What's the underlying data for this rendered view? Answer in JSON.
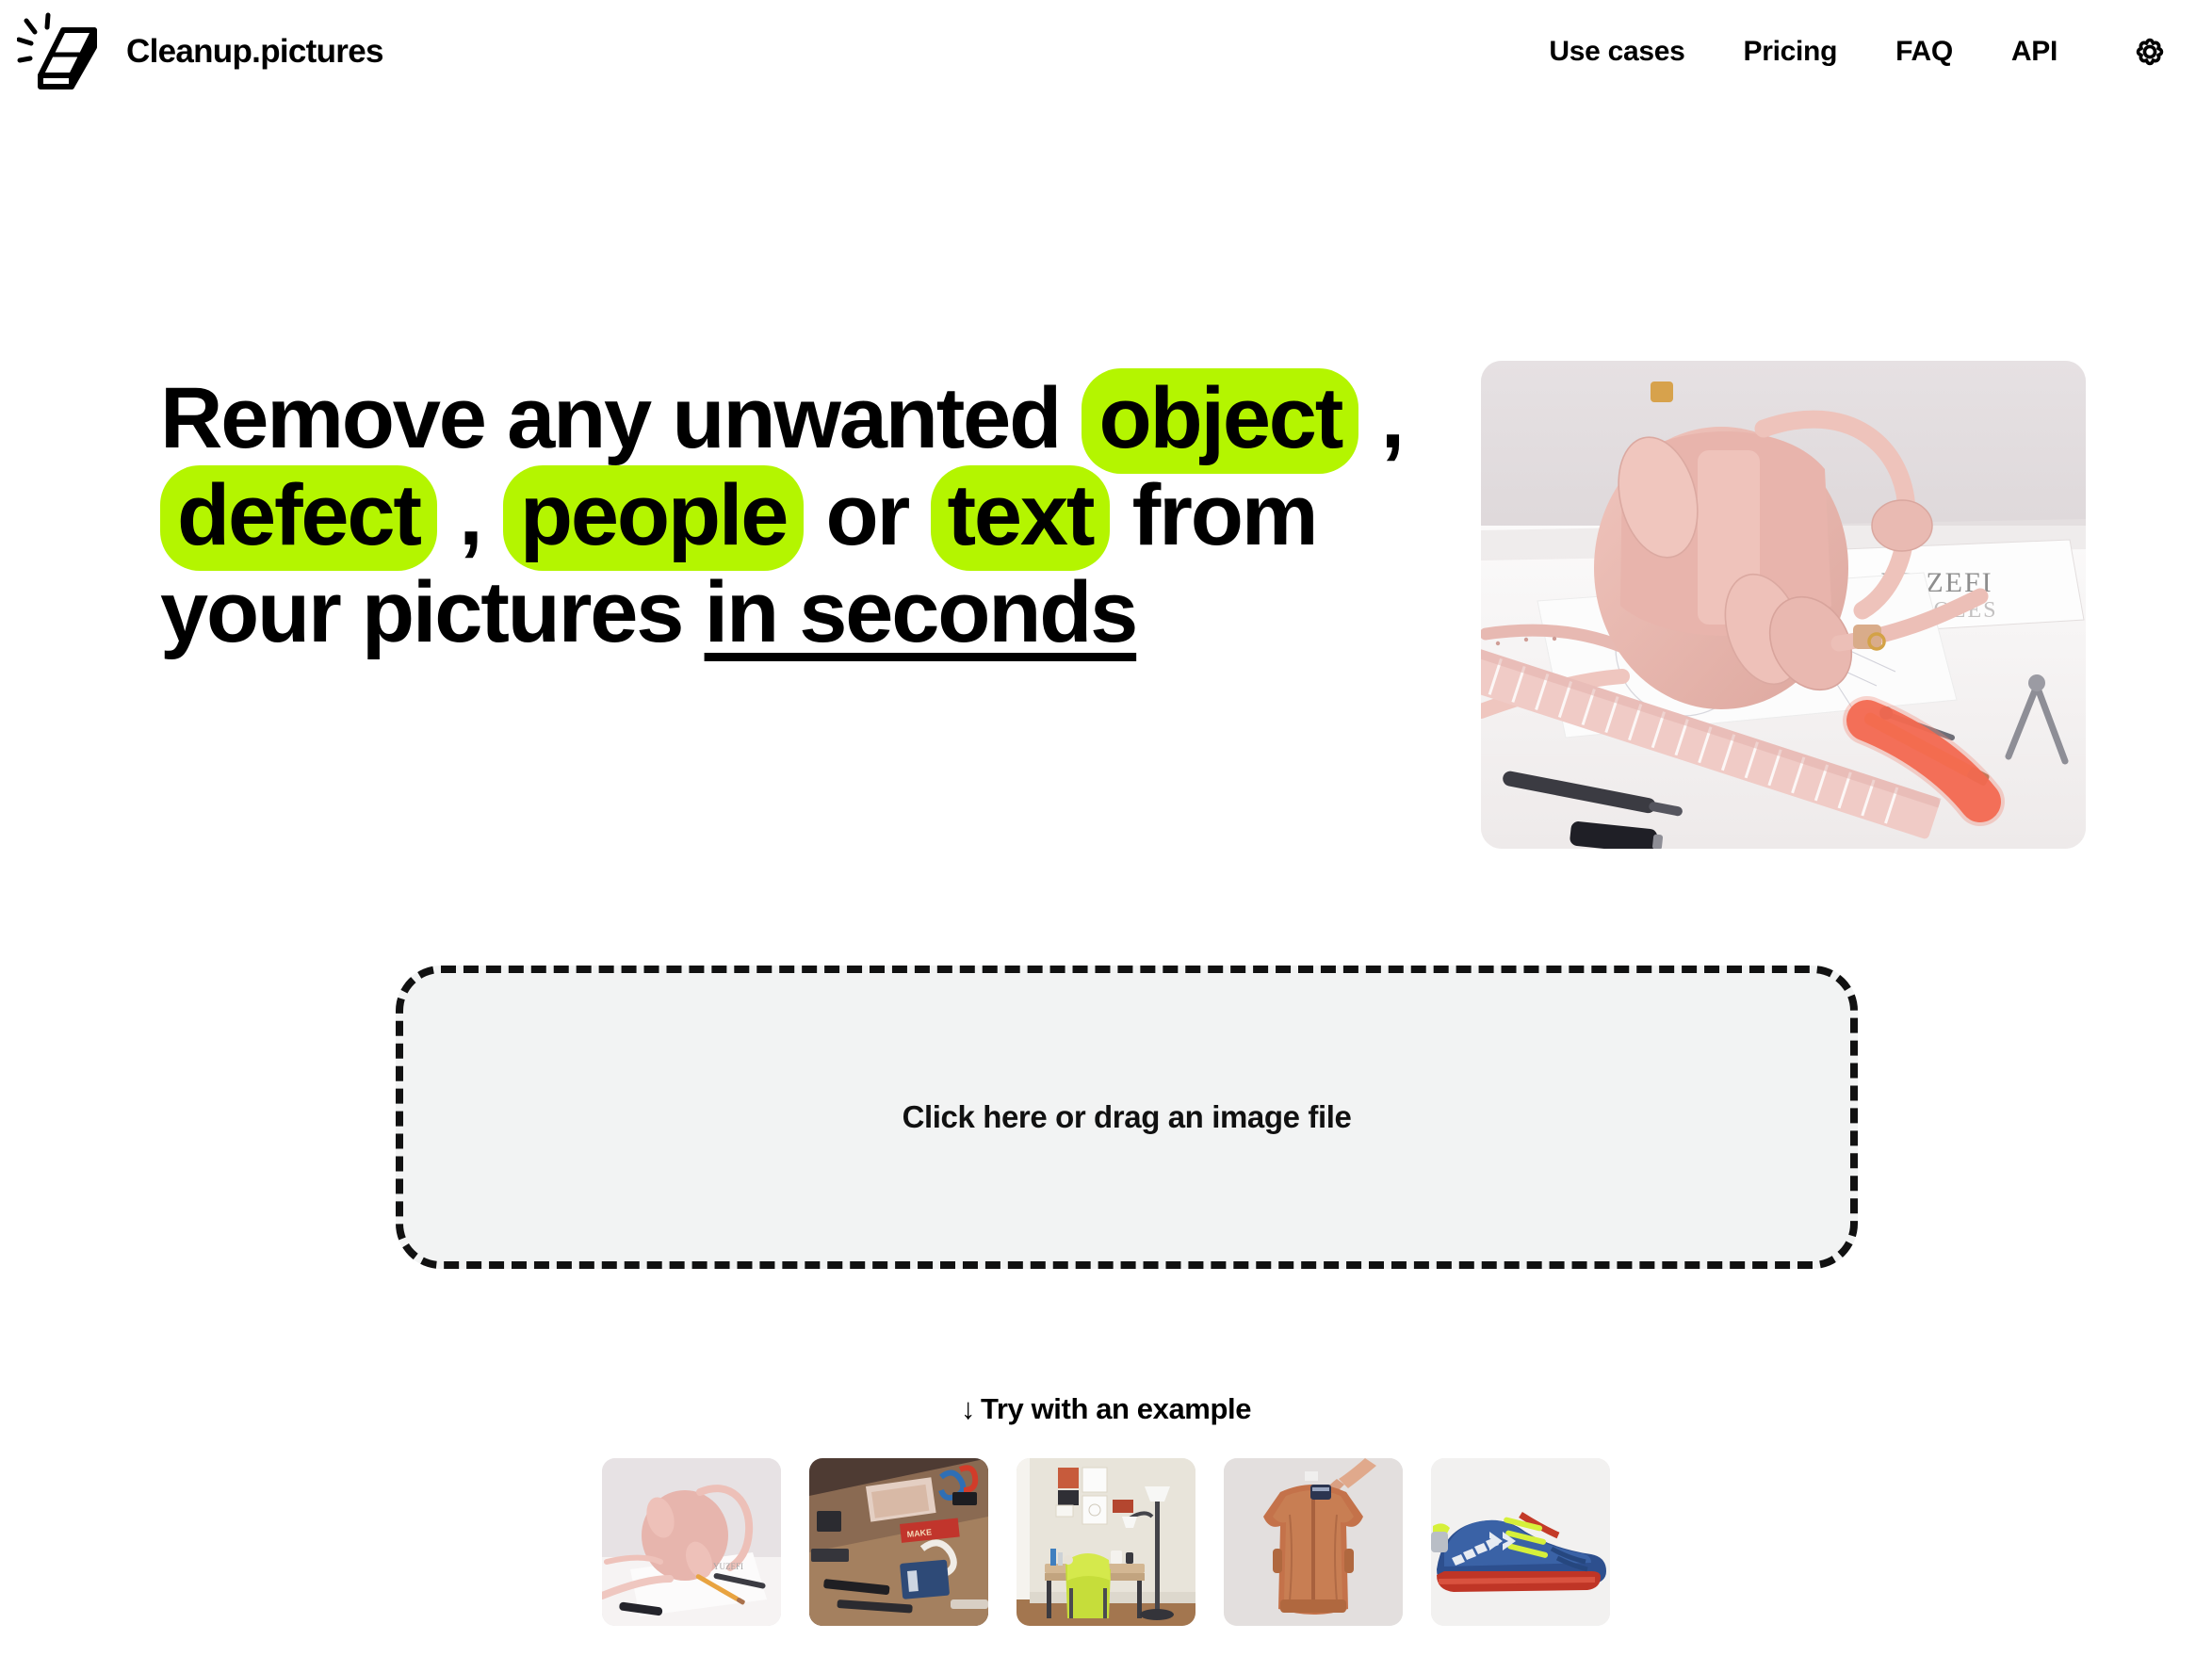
{
  "brand": {
    "name": "Cleanup.pictures",
    "logo_icon": "eraser-sparkle-icon"
  },
  "nav": {
    "items": [
      {
        "label": "Use cases",
        "name": "use-cases"
      },
      {
        "label": "Pricing",
        "name": "pricing"
      },
      {
        "label": "FAQ",
        "name": "faq"
      },
      {
        "label": "API",
        "name": "api"
      }
    ],
    "settings_icon": "gear-icon"
  },
  "hero": {
    "headline": {
      "part1": "Remove any unwanted ",
      "highlight1": "object",
      "sep1": " , ",
      "highlight2": "defect",
      "sep2": " , ",
      "highlight3": "people",
      "part2": " or ",
      "highlight4": "text",
      "part3": " from your pictures ",
      "underlined": "in seconds"
    },
    "image_alt": "pink-handbag-desk-scene",
    "highlight_color": "#b4f500"
  },
  "dropzone": {
    "label": "Click here or drag an image file",
    "background_color": "#f2f3f3",
    "border_color": "#111111"
  },
  "examples": {
    "title_arrow": "↓",
    "title": "Try with an example",
    "items": [
      {
        "name": "example-pink-handbag",
        "alt": "pink handbag on white desk"
      },
      {
        "name": "example-craft-desk",
        "alt": "craft supplies on wooden desk"
      },
      {
        "name": "example-home-office",
        "alt": "desk with green chair and floor lamp"
      },
      {
        "name": "example-bomber-jacket",
        "alt": "rust bomber jacket on hanger"
      },
      {
        "name": "example-blue-sneaker",
        "alt": "blue sneaker with neon laces"
      }
    ]
  }
}
